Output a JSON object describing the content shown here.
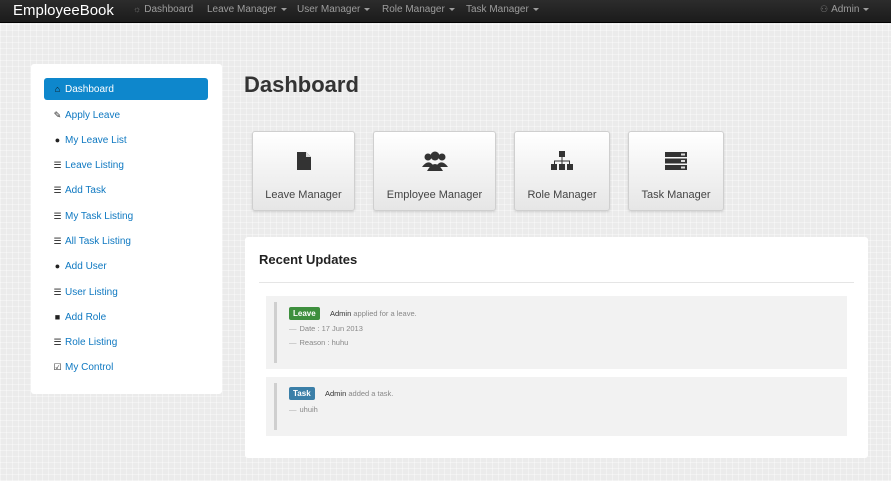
{
  "navbar": {
    "brand": "EmployeeBook",
    "items": [
      {
        "label": "Dashboard",
        "icon": "sun-icon"
      },
      {
        "label": "Leave Manager"
      },
      {
        "label": "User Manager"
      },
      {
        "label": "Role Manager"
      },
      {
        "label": "Task Manager"
      }
    ],
    "user": {
      "label": "Admin",
      "icon": "user-icon"
    }
  },
  "sidebar": {
    "items": [
      {
        "label": "Dashboard",
        "icon": "home-icon",
        "active": true
      },
      {
        "label": "Apply Leave",
        "icon": "pencil-icon"
      },
      {
        "label": "My Leave List",
        "icon": "user-icon"
      },
      {
        "label": "Leave Listing",
        "icon": "list-icon"
      },
      {
        "label": "Add Task",
        "icon": "list-icon"
      },
      {
        "label": "My Task Listing",
        "icon": "list-icon"
      },
      {
        "label": "All Task Listing",
        "icon": "list-icon"
      },
      {
        "label": "Add User",
        "icon": "user-icon"
      },
      {
        "label": "User Listing",
        "icon": "list-icon"
      },
      {
        "label": "Add Role",
        "icon": "lock-icon"
      },
      {
        "label": "Role Listing",
        "icon": "list-icon"
      },
      {
        "label": "My Control",
        "icon": "edit-icon"
      }
    ]
  },
  "main": {
    "title": "Dashboard",
    "tiles": [
      {
        "label": "Leave Manager",
        "icon": "file-icon"
      },
      {
        "label": "Employee Manager",
        "icon": "group-icon"
      },
      {
        "label": "Role Manager",
        "icon": "sitemap-icon"
      },
      {
        "label": "Task Manager",
        "icon": "server-icon"
      }
    ],
    "recent": {
      "title": "Recent Updates",
      "updates": [
        {
          "badge": "Leave",
          "user": "Admin",
          "action": "applied for a leave.",
          "details": [
            "Date : 17 Jun 2013",
            "Reason : huhu"
          ]
        },
        {
          "badge": "Task",
          "user": "Admin",
          "action": "added a task.",
          "details": [
            "uhuih"
          ]
        }
      ]
    }
  },
  "colors": {
    "accent": "#0e87cc",
    "navbar": "#1b1b1b",
    "leave_badge": "#3e8f3e",
    "task_badge": "#3b7fa8"
  }
}
